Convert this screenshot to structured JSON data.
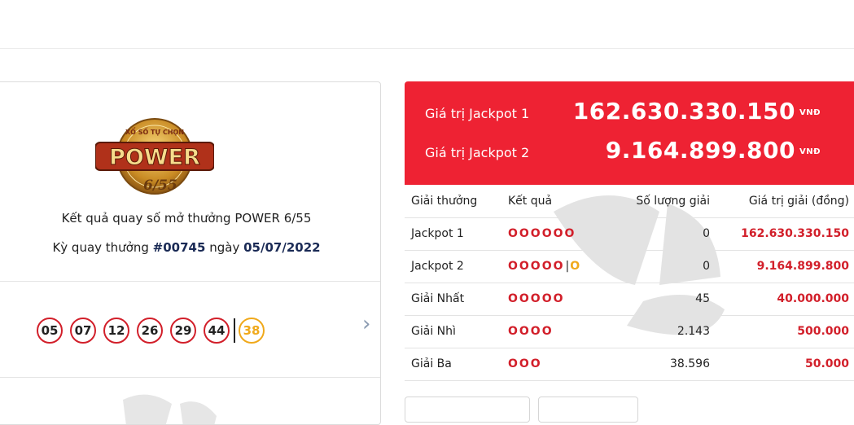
{
  "game": {
    "logo_top_text": "XỔ SỐ TỰ CHỌN",
    "logo_main_text": "POWER",
    "logo_sub_text": "6/55",
    "title": "Kết quả quay số mở thưởng POWER 6/55",
    "draw_prefix": "Kỳ quay thưởng",
    "draw_number": "#00745",
    "date_prefix": "ngày",
    "draw_date": "05/07/2022"
  },
  "balls": [
    "05",
    "07",
    "12",
    "26",
    "29",
    "44"
  ],
  "bonus_ball": "38",
  "jackpots": [
    {
      "label": "Giá trị Jackpot 1",
      "value": "162.630.330.150",
      "unit": "VNĐ"
    },
    {
      "label": "Giá trị Jackpot 2",
      "value": "9.164.899.800",
      "unit": "VNĐ"
    }
  ],
  "table": {
    "headers": {
      "prize": "Giải thưởng",
      "result": "Kết quả",
      "count": "Số lượng giải",
      "value": "Giá trị giải (đồng)"
    },
    "rows": [
      {
        "prize": "Jackpot 1",
        "result": "OOOOOO",
        "count": "0",
        "value": "162.630.330.150"
      },
      {
        "prize": "Jackpot 2",
        "result": "OOOOO",
        "result_bonus": "O",
        "count": "0",
        "value": "9.164.899.800"
      },
      {
        "prize": "Giải Nhất",
        "result": "OOOOO",
        "count": "45",
        "value": "40.000.000"
      },
      {
        "prize": "Giải Nhì",
        "result": "OOOO",
        "count": "2.143",
        "value": "500.000"
      },
      {
        "prize": "Giải Ba",
        "result": "OOO",
        "count": "38.596",
        "value": "50.000"
      }
    ]
  },
  "colors": {
    "accent_red": "#ee2233",
    "gold": "#f0a91b",
    "text_dark": "#1a2a55"
  },
  "icons": {
    "next": "chevron-right-icon"
  }
}
